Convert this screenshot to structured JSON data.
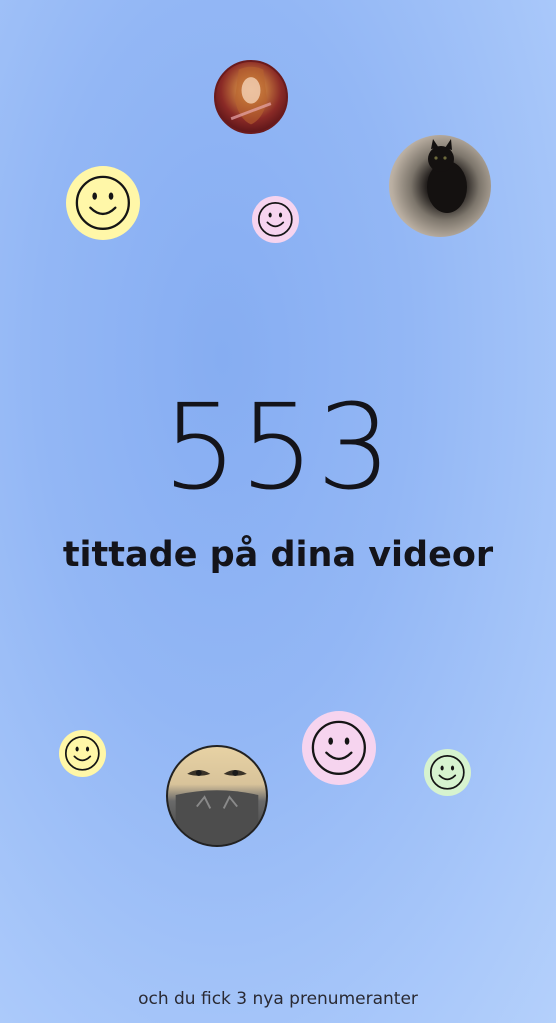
{
  "stats": {
    "view_count": "553",
    "caption": "tittade på dina videor",
    "footer": "och du fick 3 nya prenumeranter"
  },
  "bubbles": [
    {
      "kind": "avatar",
      "icon": "profile-photo-red-hair"
    },
    {
      "kind": "avatar",
      "icon": "profile-photo-black-cat"
    },
    {
      "kind": "smiley",
      "icon": "smiley-icon",
      "color": "#fff7a8"
    },
    {
      "kind": "smiley",
      "icon": "smiley-icon",
      "color": "#f6d4ef"
    },
    {
      "kind": "smiley",
      "icon": "smiley-icon",
      "color": "#fff7a8"
    },
    {
      "kind": "avatar",
      "icon": "profile-photo-eyes"
    },
    {
      "kind": "smiley",
      "icon": "smiley-icon",
      "color": "#f6d4ef"
    },
    {
      "kind": "smiley",
      "icon": "smiley-icon",
      "color": "#d6f3cf"
    }
  ]
}
